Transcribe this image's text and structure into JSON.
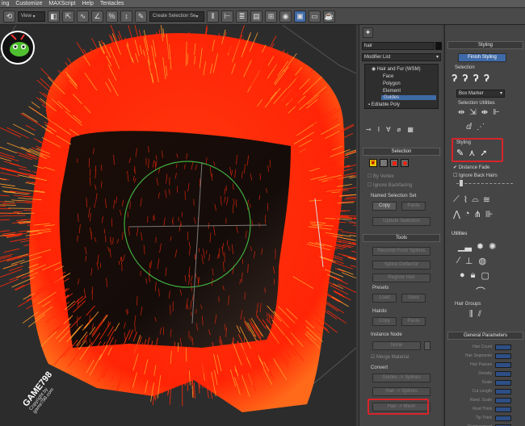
{
  "menu": [
    "ing",
    "Customize",
    "MAXScript",
    "Help",
    "Tentacles"
  ],
  "toolbar": {
    "view_dropdown": "View",
    "selection_set": "Create Selection Se",
    "icons": [
      "select-icon",
      "rotate-icon",
      "scale-icon",
      "snap-icon",
      "angle-snap-icon",
      "mirror-icon",
      "align-icon",
      "layers-icon",
      "render-setup-icon",
      "render-icon"
    ]
  },
  "command_panel": {
    "object_name": "hair",
    "modifier_list": "Modifier List",
    "stack": [
      "Hair and Fur (WSM)",
      "Face",
      "Polygon",
      "Element",
      "Guides",
      "Editable Poly"
    ],
    "selection_rollout": {
      "title": "Selection",
      "options": [
        "By Vertex",
        "Ignore Backfacing"
      ],
      "named_selection_set": "Named Selection Set",
      "copy": "Copy",
      "paste": "Paste",
      "update_selection": "Update Selection"
    },
    "tools_rollout": {
      "title": "Tools",
      "buttons": [
        "Recomb From Splines",
        "Spline Deflector",
        "Regrow Hair"
      ],
      "presets_label": "Presets",
      "load": "Load",
      "save": "Save",
      "hairdo_label": "Hairdo",
      "copy": "Copy",
      "paste": "Paste",
      "instance_node": "Instance Node",
      "none": "None",
      "merge_material": "Merge Material",
      "convert_label": "Convert",
      "guides_to_splines": "Guides -> Splines",
      "hair_to_splines": "Hair -> Splines",
      "hair_to_mesh": "Hair -> Mesh"
    }
  },
  "styling_panel": {
    "title": "Styling",
    "finish_styling": "Finish Styling",
    "selection_label": "Selection",
    "box_marker": "Box Marker",
    "selection_utilities": "Selection Utilities",
    "styling_label": "Styling",
    "distance_fade": "Distance Fade",
    "ignore_back_hairs": "Ignore Back Hairs",
    "utilities_label": "Utilities",
    "hair_groups": "Hair Groups",
    "general_parameters": "General Parameters",
    "params": [
      "Hair Count",
      "Hair Segments",
      "Hair Passes",
      "Density",
      "Scale",
      "Cut Length",
      "Rand. Scale",
      "Root Thick",
      "Tip Thick",
      "Displacement"
    ]
  },
  "watermark": {
    "name": "GAME798",
    "copyright": "Copyright by",
    "tagline": "game798.com"
  },
  "colors": {
    "hair": "#ff2a0a",
    "hair_tip": "#ff9a2a",
    "highlight": "#d8242a",
    "accent": "#3f6aa8",
    "gizmo": "#3fae3f"
  }
}
